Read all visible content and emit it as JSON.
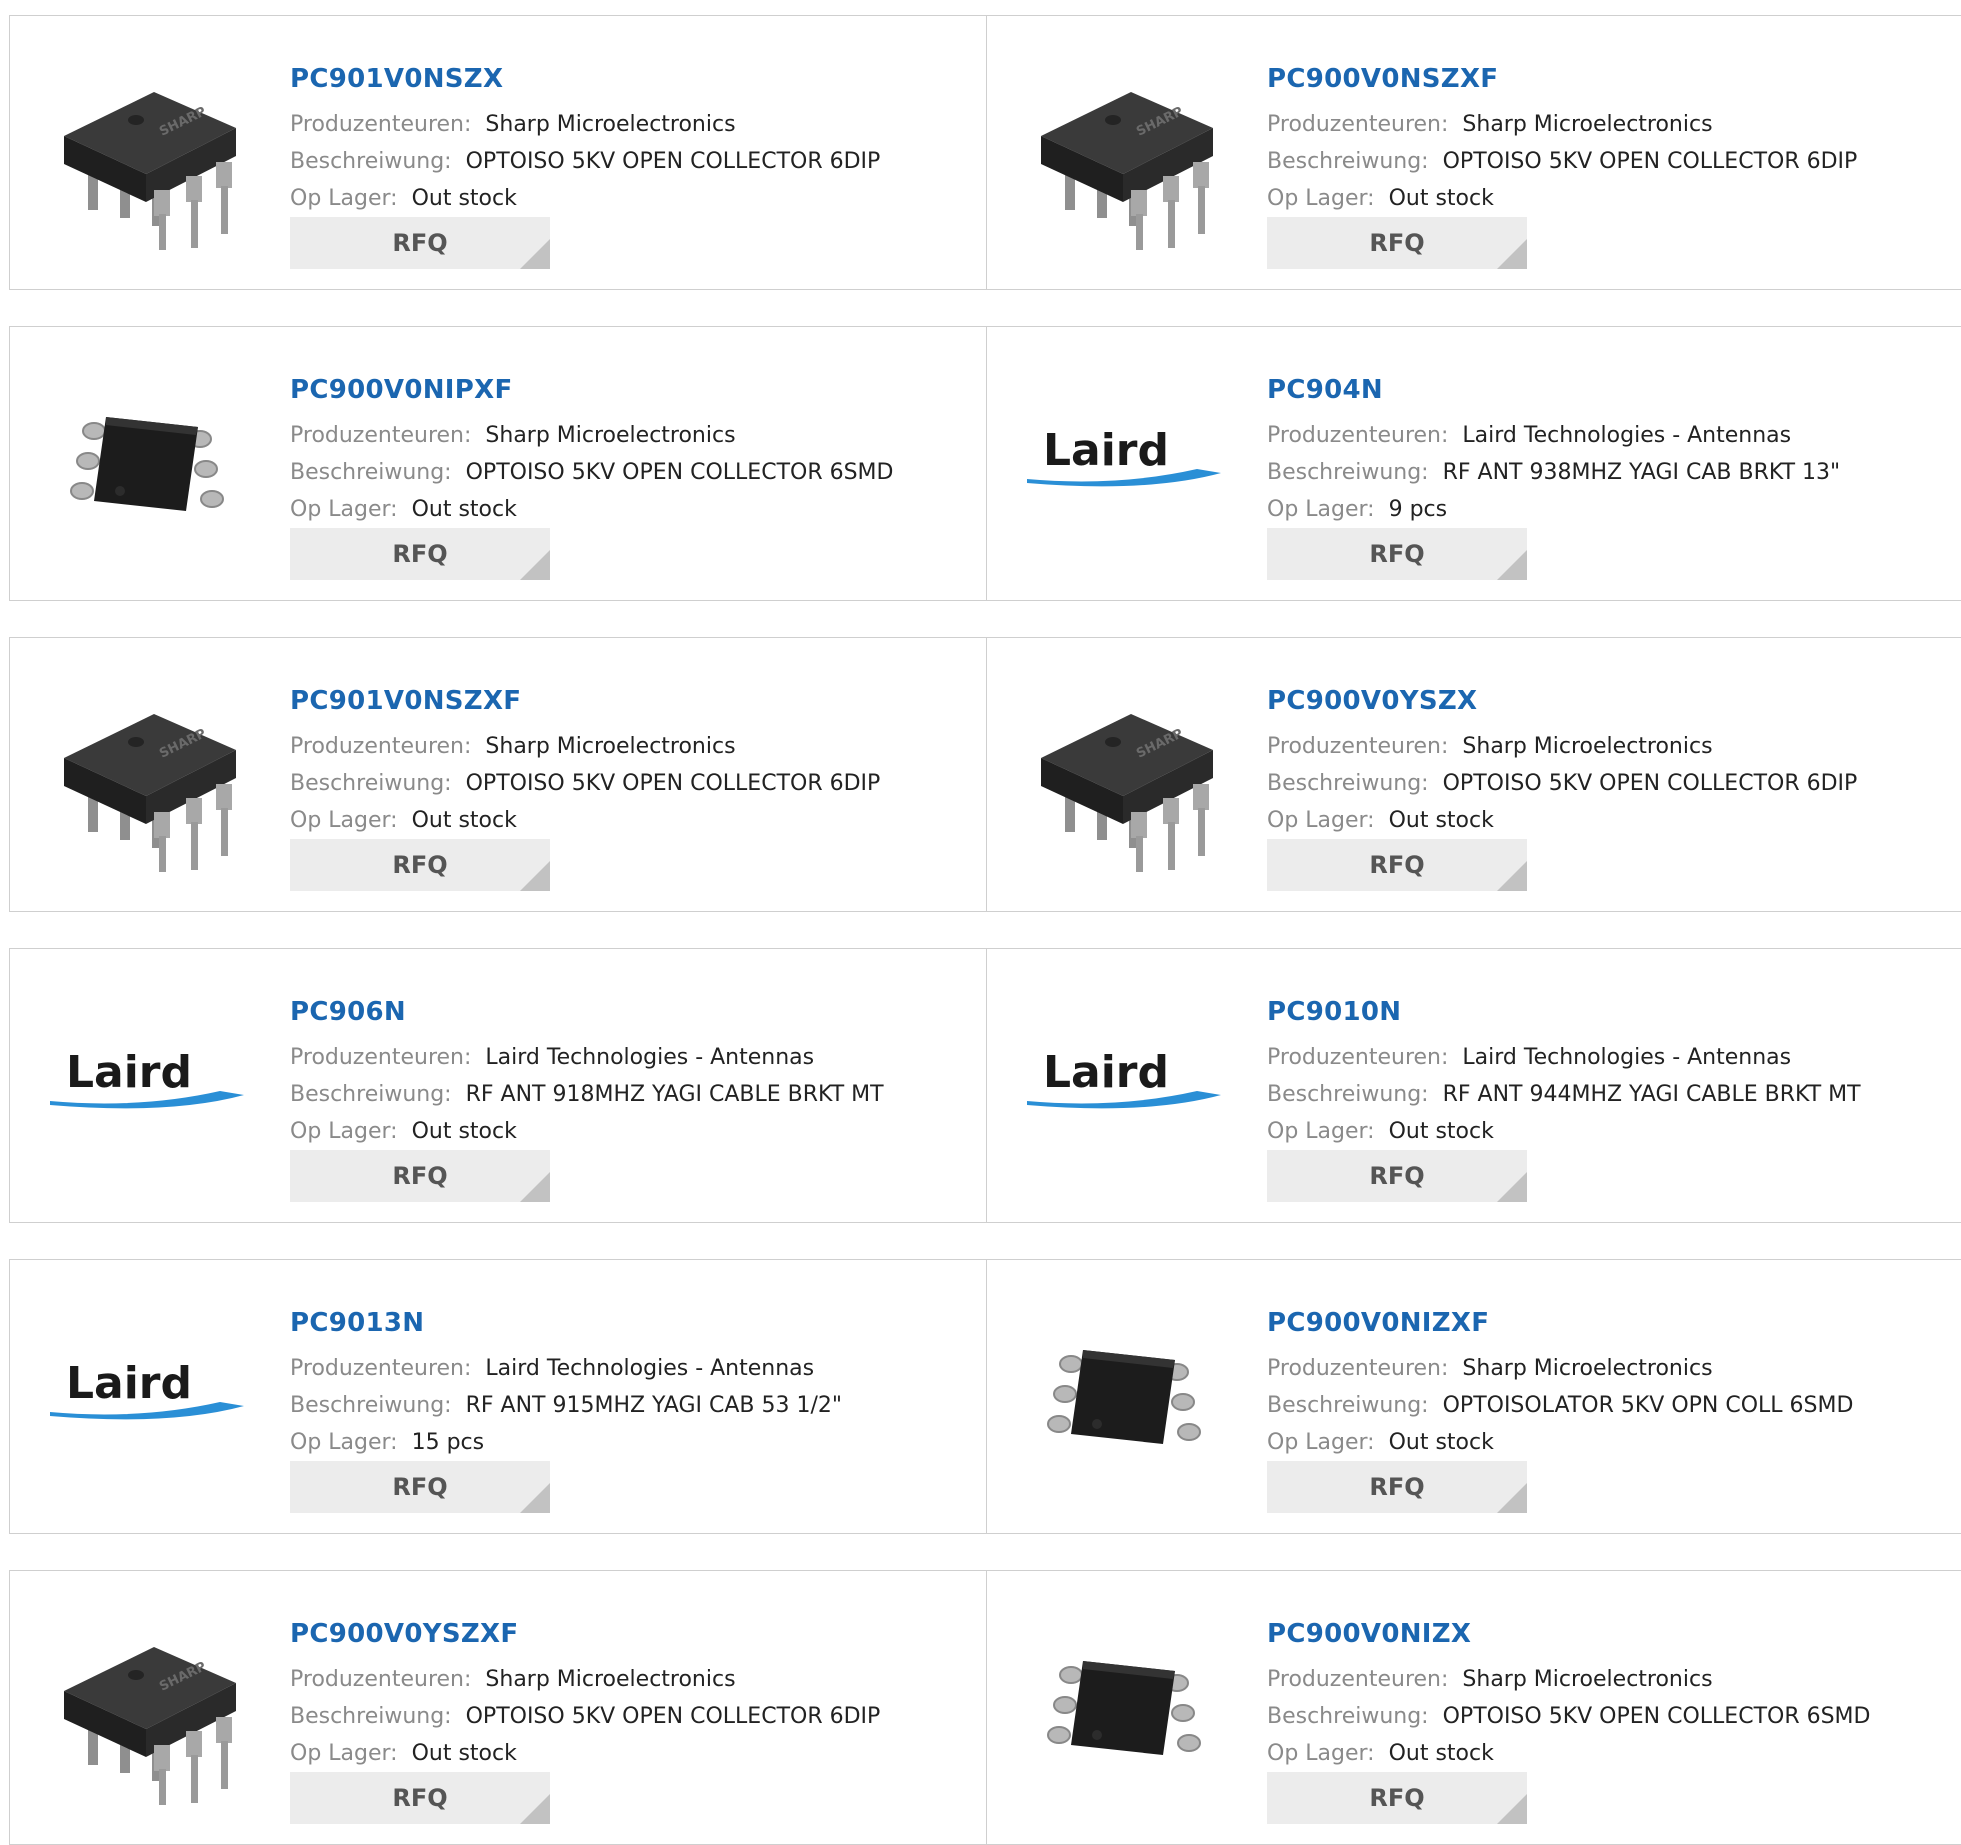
{
  "labels": {
    "manufacturer": "Produzenteuren:",
    "description": "Beschreiwung:",
    "stock": "Op Lager:",
    "rfq": "RFQ"
  },
  "colors": {
    "title_link": "#1b66b0",
    "label_gray": "#8a8a8a",
    "border": "#cfcfcf",
    "rfq_bg": "#ececec",
    "laird_text": "#1a1a1a",
    "laird_swoosh": "#2a8fd6"
  },
  "products": [
    {
      "part": "PC901V0NSZX",
      "manufacturer": "Sharp Microelectronics",
      "description": "OPTOISO 5KV OPEN COLLECTOR 6DIP",
      "stock": "Out stock",
      "image": "dip6-chip"
    },
    {
      "part": "PC900V0NSZXF",
      "manufacturer": "Sharp Microelectronics",
      "description": "OPTOISO 5KV OPEN COLLECTOR 6DIP",
      "stock": "Out stock",
      "image": "dip6-chip"
    },
    {
      "part": "PC900V0NIPXF",
      "manufacturer": "Sharp Microelectronics",
      "description": "OPTOISO 5KV OPEN COLLECTOR 6SMD",
      "stock": "Out stock",
      "image": "smd6-chip"
    },
    {
      "part": "PC904N",
      "manufacturer": "Laird Technologies - Antennas",
      "description": "RF ANT 938MHZ YAGI CAB BRKT 13\"",
      "stock": "9 pcs",
      "image": "laird-logo"
    },
    {
      "part": "PC901V0NSZXF",
      "manufacturer": "Sharp Microelectronics",
      "description": "OPTOISO 5KV OPEN COLLECTOR 6DIP",
      "stock": "Out stock",
      "image": "dip6-chip"
    },
    {
      "part": "PC900V0YSZX",
      "manufacturer": "Sharp Microelectronics",
      "description": "OPTOISO 5KV OPEN COLLECTOR 6DIP",
      "stock": "Out stock",
      "image": "dip6-chip"
    },
    {
      "part": "PC906N",
      "manufacturer": "Laird Technologies - Antennas",
      "description": "RF ANT 918MHZ YAGI CABLE BRKT MT",
      "stock": "Out stock",
      "image": "laird-logo"
    },
    {
      "part": "PC9010N",
      "manufacturer": "Laird Technologies - Antennas",
      "description": "RF ANT 944MHZ YAGI CABLE BRKT MT",
      "stock": "Out stock",
      "image": "laird-logo"
    },
    {
      "part": "PC9013N",
      "manufacturer": "Laird Technologies - Antennas",
      "description": "RF ANT 915MHZ YAGI CAB 53 1/2\"",
      "stock": "15 pcs",
      "image": "laird-logo"
    },
    {
      "part": "PC900V0NIZXF",
      "manufacturer": "Sharp Microelectronics",
      "description": "OPTOISOLATOR 5KV OPN COLL 6SMD",
      "stock": "Out stock",
      "image": "smd6-chip"
    },
    {
      "part": "PC900V0YSZXF",
      "manufacturer": "Sharp Microelectronics",
      "description": "OPTOISO 5KV OPEN COLLECTOR 6DIP",
      "stock": "Out stock",
      "image": "dip6-chip"
    },
    {
      "part": "PC900V0NIZX",
      "manufacturer": "Sharp Microelectronics",
      "description": "OPTOISO 5KV OPEN COLLECTOR 6SMD",
      "stock": "Out stock",
      "image": "smd6-chip"
    }
  ],
  "image_text": {
    "sharp": "SHARP",
    "laird": "Laird"
  }
}
